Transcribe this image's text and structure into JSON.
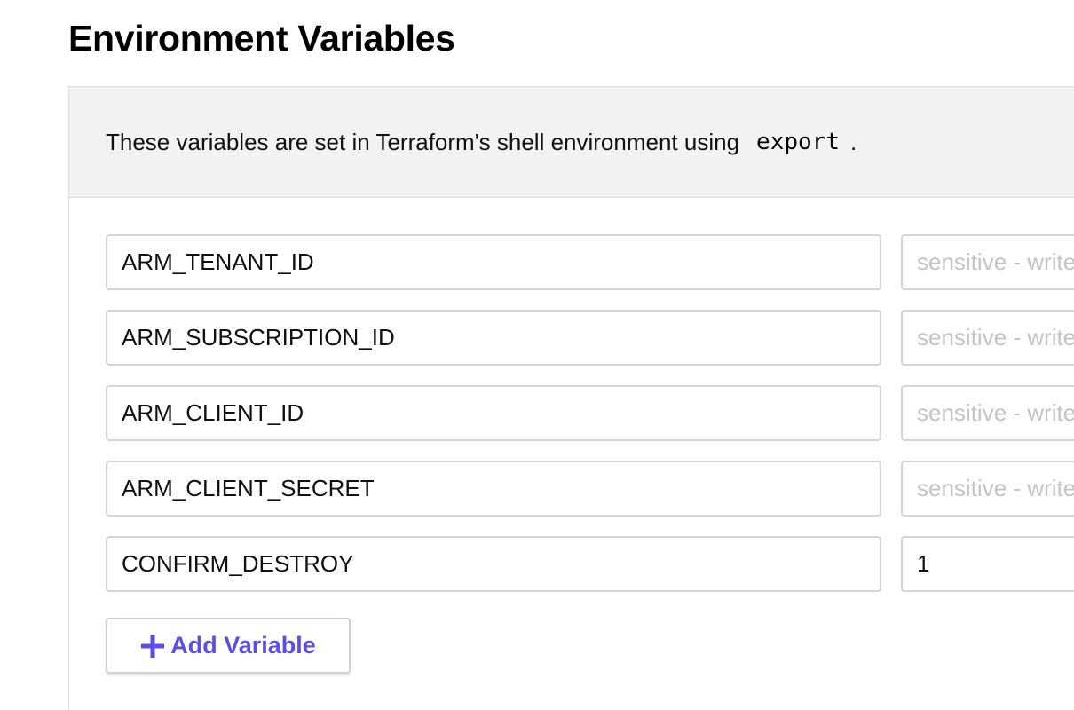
{
  "section": {
    "title": "Environment Variables",
    "description": "These variables are set in Terraform's shell environment using",
    "code": "export",
    "description_end": "."
  },
  "variables": [
    {
      "key": "ARM_TENANT_ID",
      "value": "",
      "value_placeholder": "sensitive - write only"
    },
    {
      "key": "ARM_SUBSCRIPTION_ID",
      "value": "",
      "value_placeholder": "sensitive - write only"
    },
    {
      "key": "ARM_CLIENT_ID",
      "value": "",
      "value_placeholder": "sensitive - write only"
    },
    {
      "key": "ARM_CLIENT_SECRET",
      "value": "",
      "value_placeholder": "sensitive - write only"
    },
    {
      "key": "CONFIRM_DESTROY",
      "value": "1",
      "value_placeholder": ""
    }
  ],
  "add_button": {
    "label": "Add Variable",
    "icon": "plus-icon"
  },
  "colors": {
    "accent": "#5c4ee5",
    "header_bg": "#f2f2f2",
    "placeholder": "#c4c4c4"
  }
}
